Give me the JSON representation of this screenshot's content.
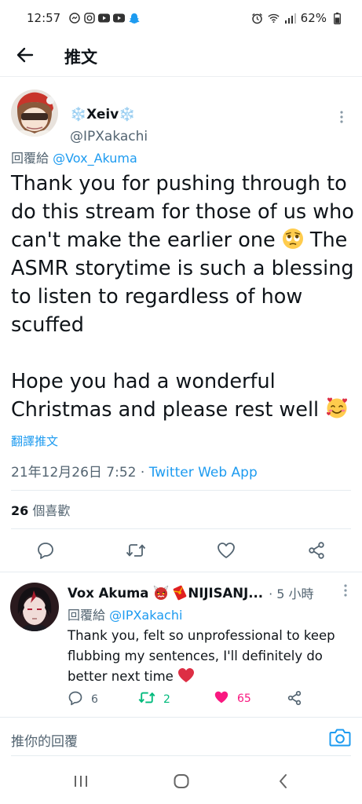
{
  "status_bar": {
    "time": "12:57",
    "battery": "62%",
    "left_icons": [
      "messenger-icon",
      "instagram-icon",
      "youtube-icon",
      "youtube-icon",
      "snapchat-icon"
    ],
    "right_icons": [
      "alarm-icon",
      "wifi-icon",
      "signal-icon",
      "battery-icon"
    ]
  },
  "app_bar": {
    "title": "推文"
  },
  "tweet": {
    "author_name": "❄️Xeiv❄️",
    "author_handle": "@IPXakachi",
    "reply_prefix": "回覆給 ",
    "reply_mention": "@Vox_Akuma",
    "text_part1": "Thank you for pushing through to do this stream for those of us who can't make the earlier one ",
    "text_part2": " The ASMR storytime is such a blessing to listen to regardless of how scuffed\n\nHope you had a wonderful Christmas and please rest well ",
    "translate": "翻譯推文",
    "timestamp": "21年12月26日 7:52",
    "separator": " · ",
    "source": "Twitter Web App",
    "like_count": "26",
    "like_label": " 個喜歡"
  },
  "reply": {
    "name": "Vox Akuma",
    "name_suffix": " NIJISANJ...",
    "time": "· 5 小時",
    "reply_prefix": "回覆給 ",
    "reply_mention": "@IPXakachi",
    "text": "Thank you, felt so unprofessional to keep flubbing my sentences, I'll definitely do better next time ",
    "reply_count": "6",
    "retweet_count": "2",
    "like_count": "65"
  },
  "compose": {
    "placeholder": "推你的回覆"
  },
  "colors": {
    "accent": "#1d9bf0",
    "secondary_text": "#536471",
    "retweet_green": "#00ba7c",
    "like_pink": "#f91880"
  }
}
